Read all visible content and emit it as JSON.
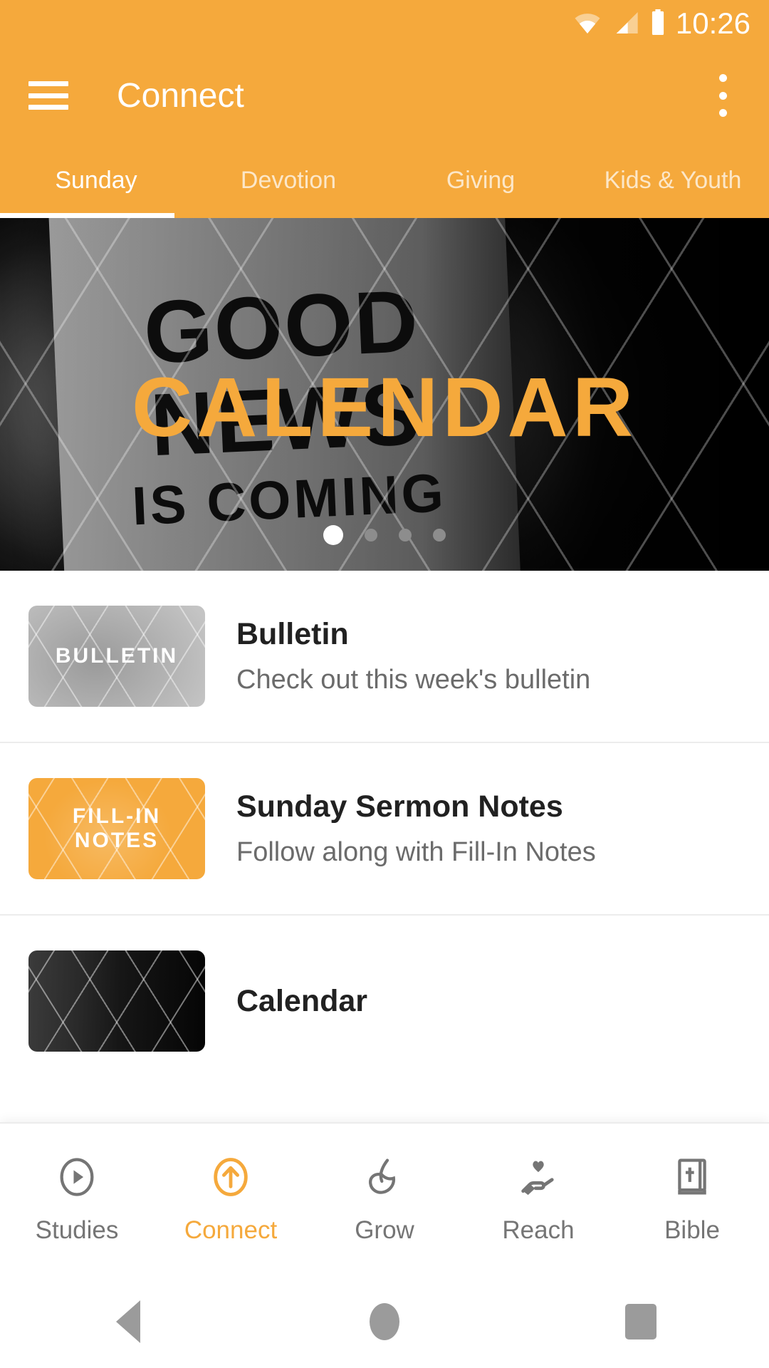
{
  "status_bar": {
    "time": "10:26",
    "icons": [
      "wifi-icon",
      "signal-icon",
      "battery-icon"
    ]
  },
  "app_bar": {
    "menu_icon": "hamburger-menu-icon",
    "title": "Connect",
    "overflow_icon": "overflow-menu-icon"
  },
  "tabs": {
    "active_index": 0,
    "items": [
      {
        "label": "Sunday"
      },
      {
        "label": "Devotion"
      },
      {
        "label": "Giving"
      },
      {
        "label": "Kids & Youth"
      }
    ]
  },
  "hero": {
    "overlay_title": "CALENDAR",
    "photo_text_line1": "GOOD",
    "photo_text_line2": "NEWS",
    "photo_text_line3": "IS COMING",
    "page_count": 4,
    "active_page": 1
  },
  "list": {
    "items": [
      {
        "thumb_label": "BULLETIN",
        "title": "Bulletin",
        "subtitle": "Check out this week's bulletin"
      },
      {
        "thumb_label": "FILL-IN NOTES",
        "title": "Sunday Sermon Notes",
        "subtitle": "Follow along with Fill-In Notes"
      },
      {
        "thumb_label": "",
        "title": "Calendar",
        "subtitle": ""
      }
    ]
  },
  "bottom_nav": {
    "active_index": 1,
    "items": [
      {
        "label": "Studies",
        "icon": "play-circle-icon"
      },
      {
        "label": "Connect",
        "icon": "arrow-up-circle-icon"
      },
      {
        "label": "Grow",
        "icon": "leaf-icon"
      },
      {
        "label": "Reach",
        "icon": "hand-heart-icon"
      },
      {
        "label": "Bible",
        "icon": "bible-book-icon"
      }
    ]
  },
  "system_nav": {
    "back": "back-button",
    "home": "home-button",
    "recents": "recents-button"
  },
  "colors": {
    "brand_orange": "#F5A93C",
    "inactive_gray": "#757575",
    "title_dark": "#212121"
  }
}
